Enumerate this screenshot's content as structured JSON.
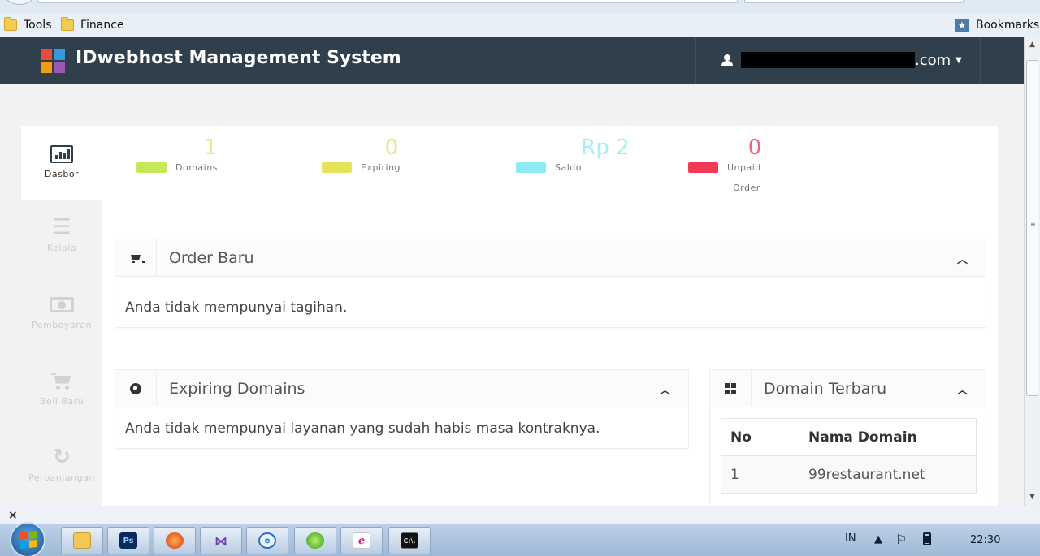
{
  "browser": {
    "bookmarks": [
      {
        "label": "Tools"
      },
      {
        "label": "Finance"
      }
    ],
    "bookmarks_menu_label": "Bookmarks"
  },
  "navbar": {
    "brand": "IDwebhost Management System",
    "user_suffix": ".com",
    "logo_colors": [
      "#e74c3c",
      "#3498db",
      "#f39c12",
      "#9b59b6"
    ]
  },
  "sidebar": {
    "items": [
      {
        "label": "Dasbor",
        "icon": "bar-chart-icon"
      },
      {
        "label": "Kelola",
        "icon": "menu-icon"
      },
      {
        "label": "Pembayaran",
        "icon": "money-icon"
      },
      {
        "label": "Beli Baru",
        "icon": "cart-icon"
      },
      {
        "label": "Perpanjangan",
        "icon": "refresh-icon"
      }
    ]
  },
  "stats": [
    {
      "value": "1",
      "label": "Domains",
      "color": "#c8e85c"
    },
    {
      "value": "0",
      "label": "Expiring",
      "color": "#e5e35a"
    },
    {
      "value": "Rp 2",
      "label": "Saldo",
      "color": "#8deaf0"
    },
    {
      "value": "0",
      "label": "Unpaid",
      "label2": "Order",
      "color": "#f03a55"
    }
  ],
  "panels": {
    "order_baru": {
      "title": "Order Baru",
      "body": "Anda tidak mempunyai tagihan."
    },
    "expiring_domains": {
      "title": "Expiring Domains",
      "body": "Anda tidak mempunyai layanan yang sudah habis masa kontraknya."
    },
    "domain_terbaru": {
      "title": "Domain Terbaru",
      "columns": [
        "No",
        "Nama Domain"
      ],
      "rows": [
        [
          "1",
          "99restaurant.net"
        ]
      ]
    }
  },
  "taskbar": {
    "apps": [
      "explorer-icon",
      "photoshop-icon",
      "firefox-icon",
      "visual-studio-icon",
      "ie-icon",
      "app-green-icon",
      "app-pink-icon",
      "cmd-icon"
    ],
    "photoshop_label": "Ps",
    "cmd_label": "C:\\.",
    "lang": "IN",
    "time": "22:30"
  }
}
